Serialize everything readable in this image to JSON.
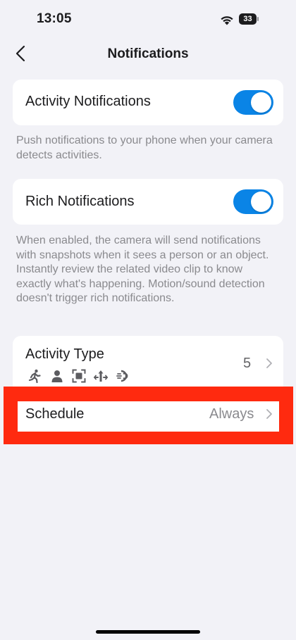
{
  "status_bar": {
    "time": "13:05",
    "battery": "33"
  },
  "nav": {
    "title": "Notifications"
  },
  "activity_notifications": {
    "label": "Activity Notifications",
    "enabled": true,
    "description": "Push notifications to your phone when your camera detects activities."
  },
  "rich_notifications": {
    "label": "Rich Notifications",
    "enabled": true,
    "description": "When enabled, the camera will send notifications with snapshots when it sees a person or an object. Instantly review the related video clip to know exactly what's happening. Motion/sound detection doesn't trigger rich notifications."
  },
  "activity_type": {
    "label": "Activity Type",
    "count": "5",
    "icons": [
      "running-person-icon",
      "person-icon",
      "object-frame-icon",
      "motion-arrows-icon",
      "sound-waves-icon"
    ]
  },
  "schedule": {
    "label": "Schedule",
    "value": "Always"
  },
  "colors": {
    "accent": "#0A84E6",
    "highlight": "#FF2A0F",
    "background": "#F2F2F7"
  }
}
